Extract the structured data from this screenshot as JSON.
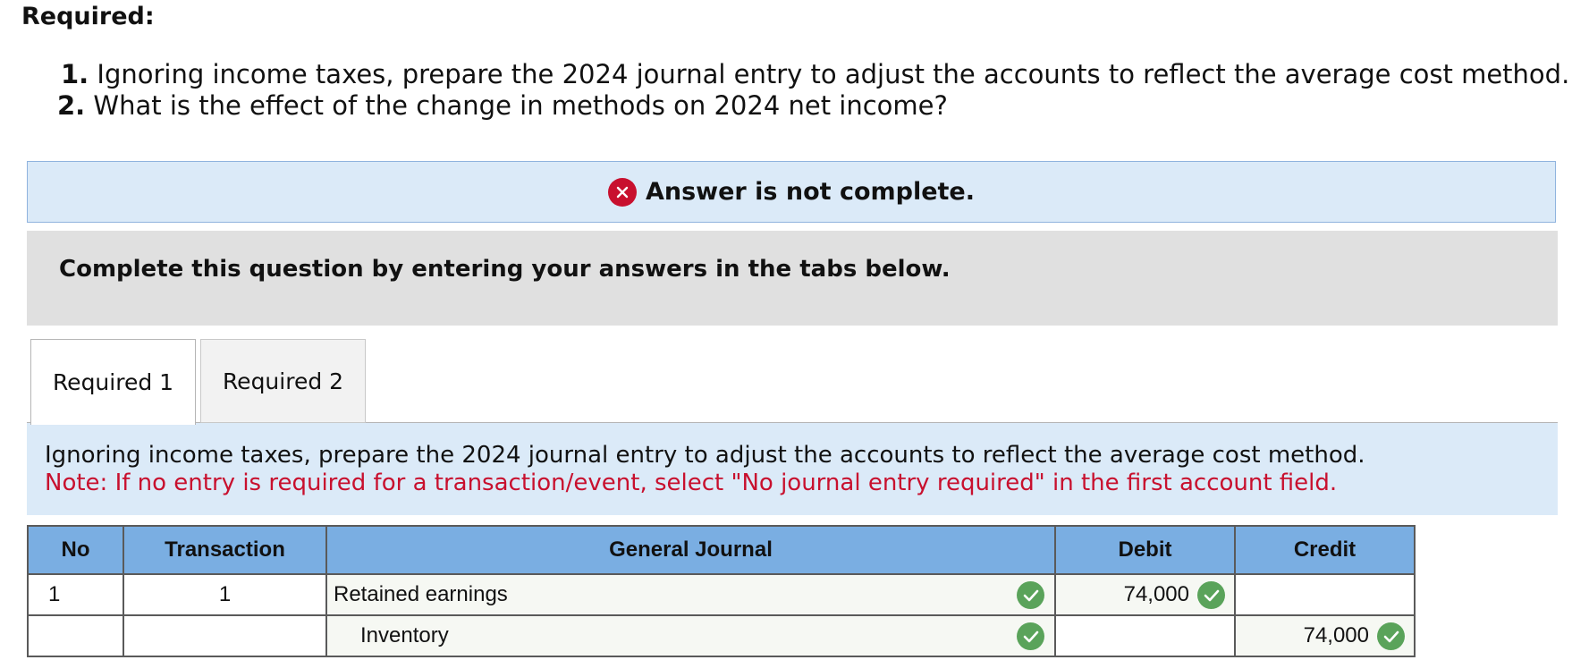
{
  "required_heading": "Required:",
  "requirements": [
    {
      "num": "1.",
      "text": "Ignoring income taxes, prepare the 2024 journal entry to adjust the accounts to reflect the average cost method."
    },
    {
      "num": "2.",
      "text": "What is the effect of the change in methods on 2024 net income?"
    }
  ],
  "alert": {
    "icon": "x-circle-icon",
    "message": "Answer is not complete.",
    "color": "#c8102e"
  },
  "instruction": "Complete this question by entering your answers in the tabs below.",
  "tabs": [
    {
      "label": "Required 1",
      "active": true
    },
    {
      "label": "Required 2",
      "active": false
    }
  ],
  "prompt": {
    "line1": "Ignoring income taxes, prepare the 2024 journal entry to adjust the accounts to reflect the average cost method.",
    "note": "Note: If no entry is required for a transaction/event, select \"No journal entry required\" in the first account field."
  },
  "table": {
    "headers": {
      "no": "No",
      "transaction": "Transaction",
      "general_journal": "General Journal",
      "debit": "Debit",
      "credit": "Credit"
    },
    "header_color": "#7aaee2",
    "rows": [
      {
        "no": "1",
        "transaction": "1",
        "account": "Retained earnings",
        "debit": "74,000",
        "credit": ""
      },
      {
        "no": "",
        "transaction": "",
        "account": "Inventory",
        "debit": "",
        "credit": "74,000"
      }
    ],
    "check_icon": "check-circle-icon",
    "check_color": "#5aa35a"
  }
}
